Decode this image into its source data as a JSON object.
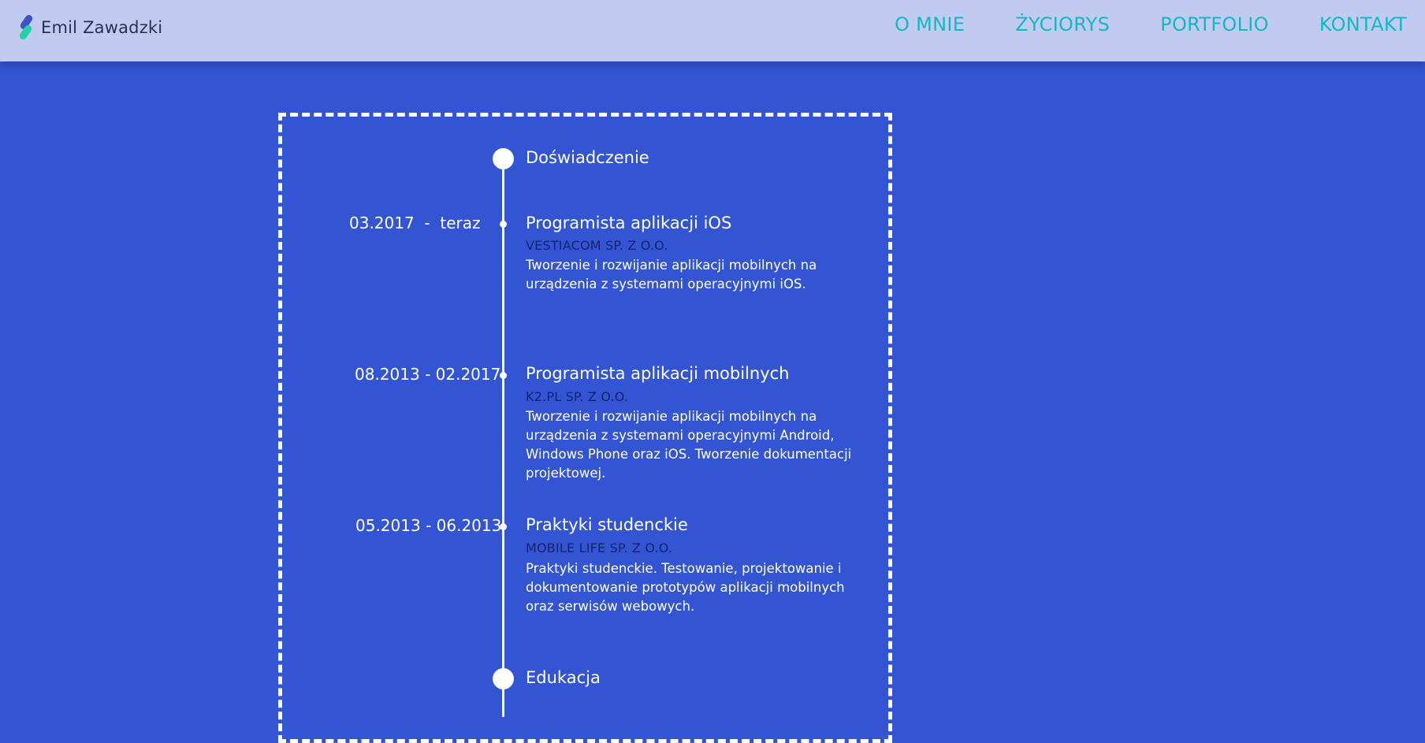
{
  "header": {
    "brand_name": "Emil Zawadzki",
    "nav": [
      "O MNIE",
      "ŻYCIORYS",
      "PORTFOLIO",
      "KONTAKT"
    ]
  },
  "timeline": {
    "sections": [
      "Doświadczenie",
      "Edukacja"
    ],
    "experience": [
      {
        "date": "03.2017  -  teraz",
        "title": "Programista aplikacji iOS",
        "company": "VESTIACOM SP. Z O.O.",
        "description": "Tworzenie i rozwijanie aplikacji mobilnych na urządzenia z systemami operacyjnymi iOS."
      },
      {
        "date": "08.2013 - 02.2017",
        "title": "Programista aplikacji mobilnych",
        "company": "K2.PL SP. Z O.O.",
        "description": "Tworzenie i rozwijanie aplikacji mobilnych na urządzenia z systemami operacyjnymi Android, Windows Phone oraz iOS. Tworzenie dokumentacji projektowej."
      },
      {
        "date": "05.2013 - 06.2013",
        "title": "Praktyki studenckie",
        "company": "MOBILE LIFE SP. Z O.O.",
        "description": "Praktyki studenckie. Testowanie, projektowanie i dokumentowanie prototypów aplikacji mobilnych oraz serwisów webowych."
      }
    ]
  },
  "colors": {
    "background": "#3355d3",
    "header_bg": "#c0cbef",
    "nav_text": "#14b7c7",
    "company_text": "#14246b",
    "logo_primary": "#3f52c9",
    "logo_accent": "#1fd3a3"
  },
  "icons": {
    "logo": "logo-icon"
  }
}
